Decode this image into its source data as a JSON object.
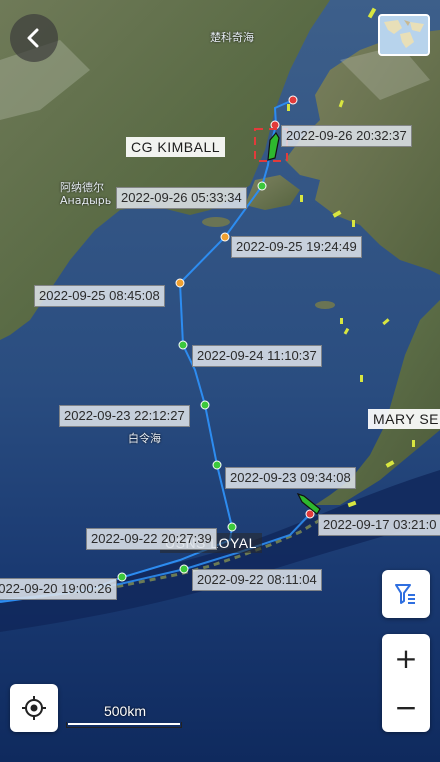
{
  "map": {
    "sea_name": "楚科奇海",
    "bering_sea_name": "白令海",
    "town_name_cn": "阿纳德尔",
    "town_name_ru": "Анадырь"
  },
  "ships": [
    {
      "name": "CG KIMBALL"
    },
    {
      "name": "USNS LOYAL"
    },
    {
      "name": "MARY SE"
    }
  ],
  "track_points": [
    {
      "label": "2022-09-26 20:32:37"
    },
    {
      "label": "2022-09-26 05:33:34"
    },
    {
      "label": "2022-09-25 19:24:49"
    },
    {
      "label": "2022-09-25 08:45:08"
    },
    {
      "label": "2022-09-24 11:10:37"
    },
    {
      "label": "2022-09-23 22:12:27"
    },
    {
      "label": "2022-09-23 09:34:08"
    },
    {
      "label": "2022-09-22 20:27:39"
    },
    {
      "label": "2022-09-22 08:11:04"
    },
    {
      "label": "2022-09-20 19:00:26"
    },
    {
      "label": "2022-09-17 03:21:0"
    }
  ],
  "controls": {
    "back_icon": "back-arrow-icon",
    "filter_icon": "filter-icon",
    "zoom_in_label": "+",
    "zoom_out_label": "−",
    "locate_icon": "locate-icon"
  },
  "scale": {
    "label": "500km"
  },
  "colors": {
    "track_line": "#2d8cf0",
    "point_green": "#3cc83c",
    "point_orange": "#f0a030",
    "point_red": "#e23b3b",
    "ship_green": "#2eb82e",
    "filter_blue": "#2f6fe0"
  }
}
